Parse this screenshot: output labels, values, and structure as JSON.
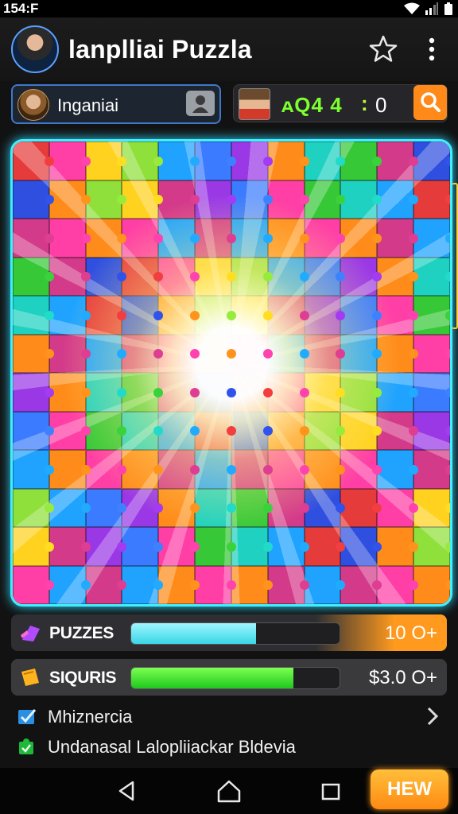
{
  "status_bar": {
    "time": "154:F"
  },
  "header": {
    "title": "lanplliai Puzzla"
  },
  "player": {
    "name": "Inganiai"
  },
  "score": {
    "code": "ᴀQ4 4",
    "separator": ":",
    "value": "0"
  },
  "board": {
    "colors": [
      "#e63b3b",
      "#ff8c1a",
      "#ffd21f",
      "#37c837",
      "#1fa3ff",
      "#2f4fe0",
      "#9a38e6",
      "#ff3fa5",
      "#1fd1c0",
      "#8fe03a",
      "#d43a8a",
      "#3a7bff"
    ]
  },
  "progress": [
    {
      "label": "PUZZES",
      "fill_pct": 60,
      "amount": "10 O+"
    },
    {
      "label": "SIQURIS",
      "fill_pct": 78,
      "amount": "$3.0 O+"
    }
  ],
  "links": [
    {
      "label": "Mhiznercia"
    },
    {
      "label": "Undanasal Lalopliiackar Bldevia"
    }
  ],
  "bottom": {
    "action_label": "HEW"
  }
}
